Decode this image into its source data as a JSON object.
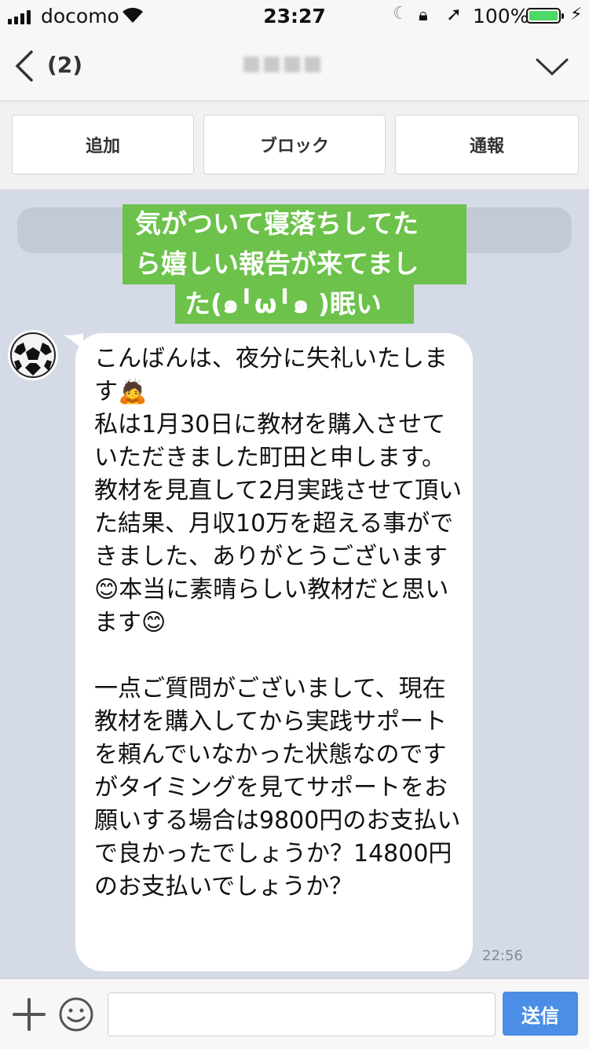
{
  "status_bar": {
    "carrier": "docomo",
    "time": "23:27",
    "battery": "100%"
  },
  "nav": {
    "back_count": "(2)"
  },
  "actions": {
    "add": "追加",
    "block": "ブロック",
    "report": "通報"
  },
  "overlay": {
    "lines": [
      "気がついて寝落ちしてた",
      "ら嬉しい報告が来てまし",
      "た(๑╹ω╹๑ )眠い"
    ]
  },
  "message": {
    "text": "こんばんは、夜分に失礼いたします🙇\n私は1月30日に教材を購入させていただきました町田と申します。\n教材を見直して2月実践させて頂いた結果、月収10万を超える事ができました、ありがとうございます😊本当に素晴らしい教材だと思います😊\n\n一点ご質問がございまして、現在教材を購入してから実践サポートを頼んでいなかった状態なのですがタイミングを見てサポートをお願いする場合は9800円のお支払いで良かったでしょうか？14800円のお支払いでしょうか？",
    "time": "22:56"
  },
  "input": {
    "send_label": "送信"
  },
  "colors": {
    "chat_bg": "#d5dbe6",
    "overlay_green": "#6cc24a",
    "send_blue": "#4a8ee6"
  }
}
